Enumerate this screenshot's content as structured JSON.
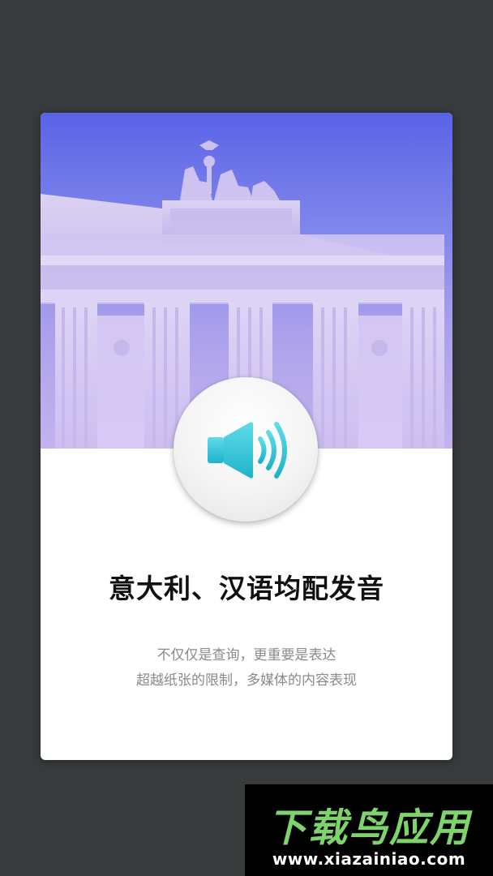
{
  "card": {
    "image_name": "brandenburg-gate-photo",
    "title": "意大利、汉语均配发音",
    "description_lines": [
      "不仅仅是查询，更重要是表达",
      "超越纸张的限制，多媒体的内容表现"
    ],
    "speaker_icon": "speaker-sound-icon"
  },
  "watermark": {
    "brand": "下载鸟应用",
    "url": "www.xiazainiao.com"
  },
  "colors": {
    "background": "#373b3c",
    "card": "#ffffff",
    "hero_sky": "#5a63e6",
    "speaker_accent": "#2ec4d6",
    "title_text": "#111111",
    "desc_text": "#8a8a8a",
    "watermark_green": "#7fd36d"
  }
}
